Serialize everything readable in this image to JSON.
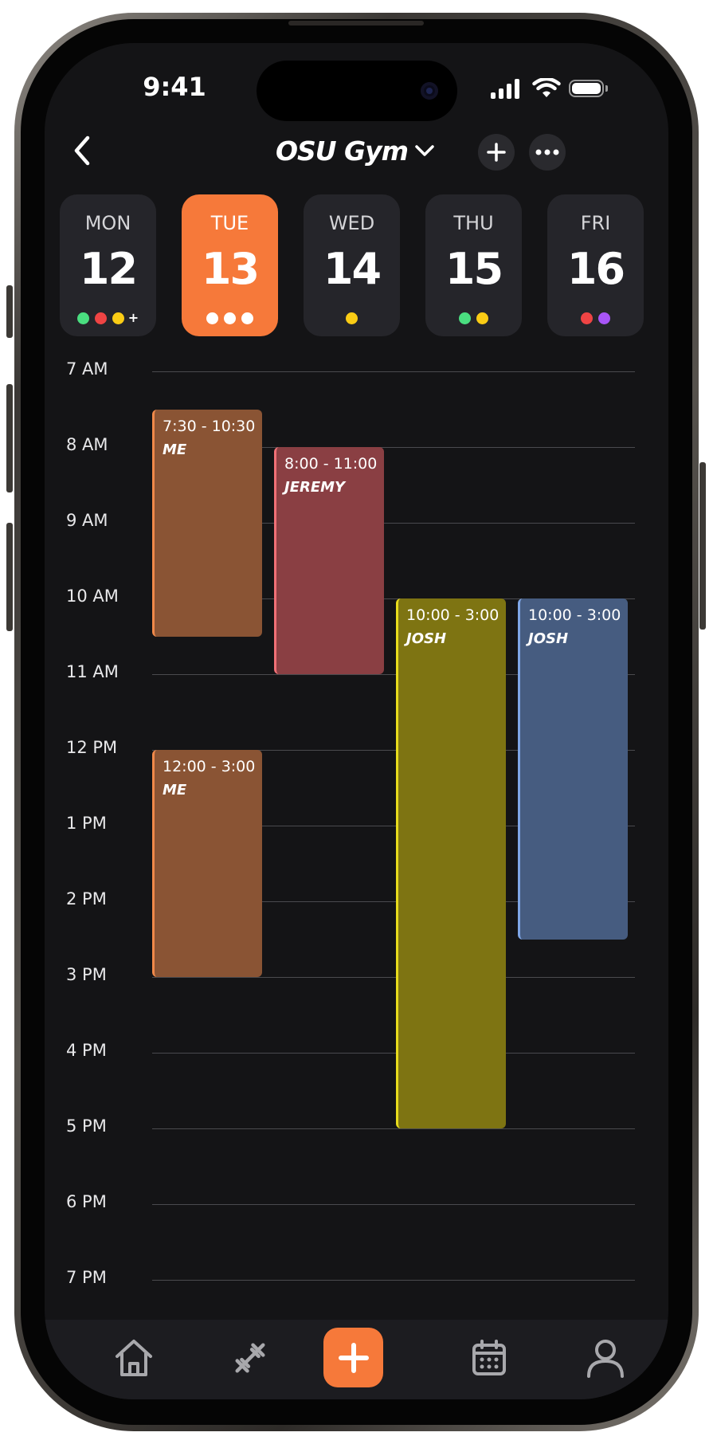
{
  "status_bar": {
    "time": "9:41"
  },
  "header": {
    "title": "OSU Gym"
  },
  "days": [
    {
      "name": "MON",
      "number": "12",
      "dots": [
        "#4ade80",
        "#ef4444",
        "#facc15"
      ],
      "more": "+",
      "active": false
    },
    {
      "name": "TUE",
      "number": "13",
      "dots": [
        "#ffffff",
        "#ffffff",
        "#ffffff"
      ],
      "active": true
    },
    {
      "name": "WED",
      "number": "14",
      "dots": [
        "#facc15"
      ],
      "active": false
    },
    {
      "name": "THU",
      "number": "15",
      "dots": [
        "#4ade80",
        "#facc15"
      ],
      "active": false
    },
    {
      "name": "FRI",
      "number": "16",
      "dots": [
        "#ef4444",
        "#a855f7"
      ],
      "active": false
    }
  ],
  "timeline": {
    "hours": [
      "7 AM",
      "8 AM",
      "9 AM",
      "10 AM",
      "11 AM",
      "12 PM",
      "1 PM",
      "2 PM",
      "3 PM",
      "4 PM",
      "5 PM",
      "6 PM",
      "7 PM"
    ]
  },
  "events": [
    {
      "time": "7:30 - 10:30",
      "name": "ME",
      "start_hour": 7.5,
      "end_hour": 10.5,
      "column": 0,
      "fill": "#8a5434",
      "border": "#f0894a"
    },
    {
      "time": "8:00 - 11:00",
      "name": "JEREMY",
      "start_hour": 8.0,
      "end_hour": 11.0,
      "column": 1,
      "fill": "#8a3f43",
      "border": "#f07076"
    },
    {
      "time": "10:00 - 3:00",
      "name": "JOSH",
      "start_hour": 10.0,
      "end_hour": 17.0,
      "column": 2,
      "fill": "#7e7412",
      "border": "#e8dc1c"
    },
    {
      "time": "10:00 - 3:00",
      "name": "JOSH",
      "start_hour": 10.0,
      "end_hour": 14.5,
      "column": 3,
      "fill": "#465c80",
      "border": "#7fa6e6"
    },
    {
      "time": "12:00 - 3:00",
      "name": "ME",
      "start_hour": 12.0,
      "end_hour": 15.0,
      "column": 0,
      "fill": "#8a5434",
      "border": "#f0894a"
    }
  ],
  "colors": {
    "accent": "#f6793a",
    "background": "#141416",
    "card": "#25252a"
  },
  "tabbar": {
    "items": [
      "home-icon",
      "dumbbell-icon",
      "add-icon",
      "calendar-icon",
      "profile-icon"
    ]
  }
}
